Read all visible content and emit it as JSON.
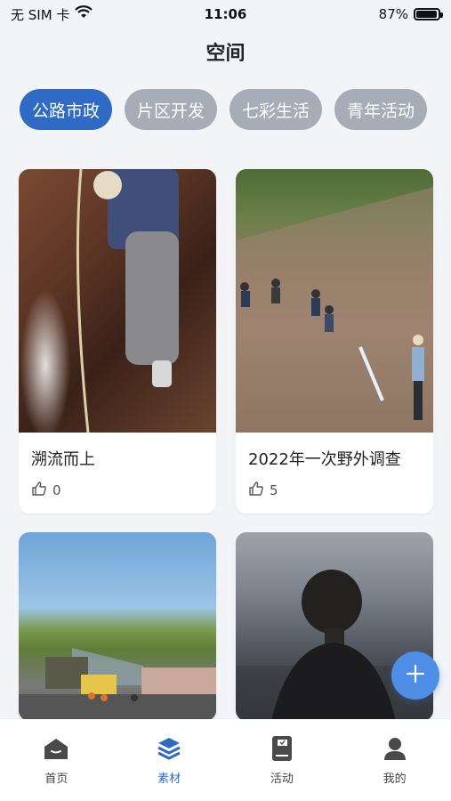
{
  "status_bar": {
    "carrier": "无 SIM 卡",
    "time": "11:06",
    "battery_percent": "87%",
    "battery_level": 0.87
  },
  "header": {
    "title": "空间"
  },
  "categories": [
    {
      "label": "公路市政",
      "active": true
    },
    {
      "label": "片区开发",
      "active": false
    },
    {
      "label": "七彩生活",
      "active": false
    },
    {
      "label": "青年活动",
      "active": false
    }
  ],
  "posts": [
    {
      "title": "溯流而上",
      "likes": "0",
      "image": "worker-climbing-waterfall-photo"
    },
    {
      "title": "2022年一次野外调查",
      "likes": "5",
      "image": "field-survey-slope-photo"
    },
    {
      "title": "",
      "likes": "",
      "image": "road-paving-machinery-photo"
    },
    {
      "title": "",
      "likes": "",
      "image": "man-silhouette-sky-photo"
    }
  ],
  "tabbar": {
    "items": [
      {
        "label": "首页",
        "icon": "home-icon",
        "active": false
      },
      {
        "label": "素材",
        "icon": "layers-icon",
        "active": true
      },
      {
        "label": "活动",
        "icon": "book-icon",
        "active": false
      },
      {
        "label": "我的",
        "icon": "user-icon",
        "active": false
      }
    ]
  },
  "colors": {
    "accent": "#2f6bc4",
    "chip_inactive": "#a6adb6",
    "fab": "#4e8ee6",
    "background": "#f3f4f8"
  }
}
